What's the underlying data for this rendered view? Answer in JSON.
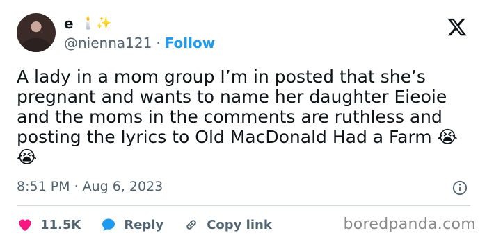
{
  "user": {
    "name": "e",
    "name_emojis": "🕯️✨",
    "handle": "@nienna121",
    "separator": "·",
    "follow_label": "Follow"
  },
  "tweet": {
    "text": "A lady in a mom group I’m in posted that she’s\npregnant and wants to name her daughter Eieoie\nand the moms in the comments are ruthless and\nposting the lyrics to Old MacDonald Had a Farm 😭\n😭",
    "time": "8:51 PM",
    "meta_separator": "·",
    "date": "Aug 6, 2023"
  },
  "actions": {
    "likes": "11.5K",
    "reply_label": "Reply",
    "copy_link_label": "Copy link"
  },
  "watermark": "boredpanda.com",
  "colors": {
    "like": "#f91880",
    "reply": "#1d9bf0",
    "link": "#1d9bf0",
    "text_secondary": "#536471"
  },
  "icons": [
    "x-logo-icon",
    "info-icon",
    "heart-icon",
    "reply-bubble-icon",
    "link-icon"
  ]
}
